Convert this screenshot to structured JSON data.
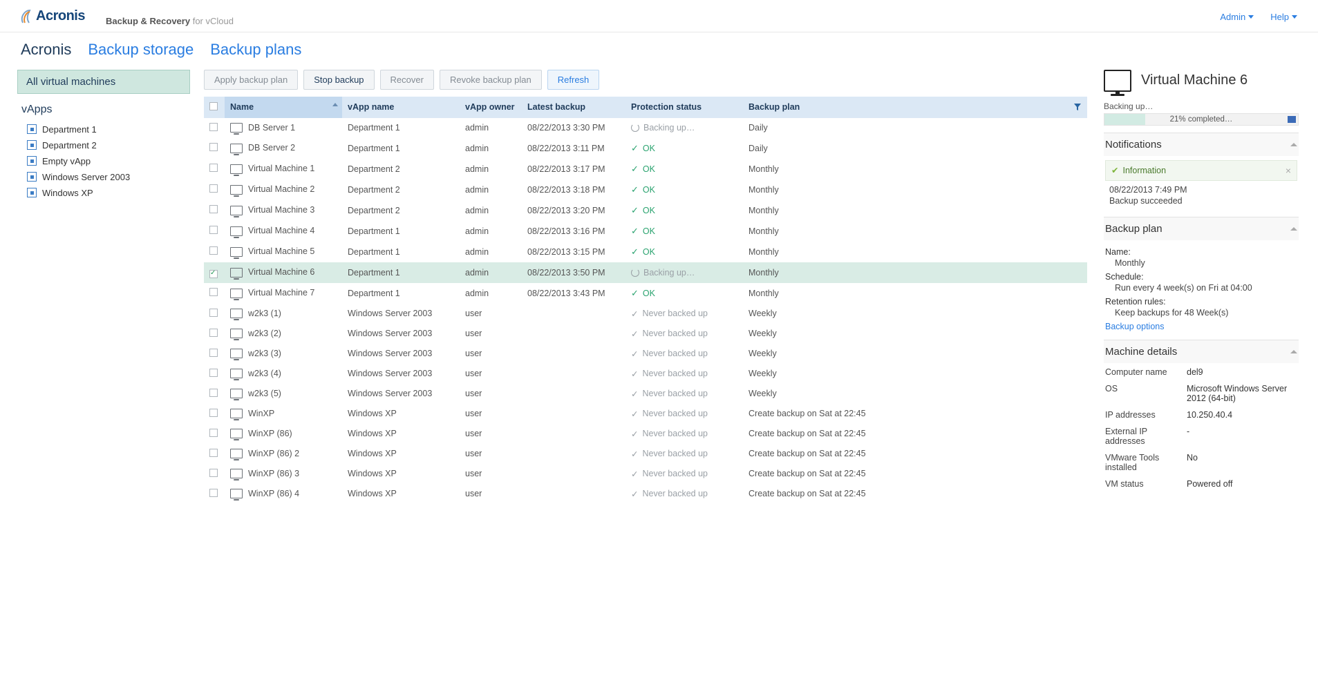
{
  "header": {
    "brand": "Acronis",
    "product_strong": "Backup & Recovery",
    "product_light": " for vCloud",
    "menu": {
      "admin": "Admin",
      "help": "Help"
    }
  },
  "tabs": {
    "t1": "Acronis",
    "t2": "Backup storage",
    "t3": "Backup plans"
  },
  "sidebar": {
    "selected": "All virtual machines",
    "heading": "vApps",
    "items": [
      "Department 1",
      "Department 2",
      "Empty vApp",
      "Windows Server 2003",
      "Windows XP"
    ]
  },
  "toolbar": {
    "apply": "Apply backup plan",
    "stop": "Stop backup",
    "recover": "Recover",
    "revoke": "Revoke backup plan",
    "refresh": "Refresh"
  },
  "columns": {
    "name": "Name",
    "vapp": "vApp name",
    "owner": "vApp owner",
    "latest": "Latest backup",
    "status": "Protection status",
    "plan": "Backup plan"
  },
  "rows": [
    {
      "name": "DB Server 1",
      "vapp": "Department 1",
      "owner": "admin",
      "latest": "08/22/2013 3:30 PM",
      "status": "Backing up…",
      "kind": "busy",
      "plan": "Daily",
      "sel": false
    },
    {
      "name": "DB Server 2",
      "vapp": "Department 1",
      "owner": "admin",
      "latest": "08/22/2013 3:11 PM",
      "status": "OK",
      "kind": "ok",
      "plan": "Daily",
      "sel": false
    },
    {
      "name": "Virtual Machine 1",
      "vapp": "Department 2",
      "owner": "admin",
      "latest": "08/22/2013 3:17 PM",
      "status": "OK",
      "kind": "ok",
      "plan": "Monthly",
      "sel": false
    },
    {
      "name": "Virtual Machine 2",
      "vapp": "Department 2",
      "owner": "admin",
      "latest": "08/22/2013 3:18 PM",
      "status": "OK",
      "kind": "ok",
      "plan": "Monthly",
      "sel": false
    },
    {
      "name": "Virtual Machine 3",
      "vapp": "Department 2",
      "owner": "admin",
      "latest": "08/22/2013 3:20 PM",
      "status": "OK",
      "kind": "ok",
      "plan": "Monthly",
      "sel": false
    },
    {
      "name": "Virtual Machine 4",
      "vapp": "Department 1",
      "owner": "admin",
      "latest": "08/22/2013 3:16 PM",
      "status": "OK",
      "kind": "ok",
      "plan": "Monthly",
      "sel": false
    },
    {
      "name": "Virtual Machine 5",
      "vapp": "Department 1",
      "owner": "admin",
      "latest": "08/22/2013 3:15 PM",
      "status": "OK",
      "kind": "ok",
      "plan": "Monthly",
      "sel": false
    },
    {
      "name": "Virtual Machine 6",
      "vapp": "Department 1",
      "owner": "admin",
      "latest": "08/22/2013 3:50 PM",
      "status": "Backing up…",
      "kind": "busy",
      "plan": "Monthly",
      "sel": true
    },
    {
      "name": "Virtual Machine 7",
      "vapp": "Department 1",
      "owner": "admin",
      "latest": "08/22/2013 3:43 PM",
      "status": "OK",
      "kind": "ok",
      "plan": "Monthly",
      "sel": false
    },
    {
      "name": "w2k3 (1)",
      "vapp": "Windows Server 2003",
      "owner": "user",
      "latest": "",
      "status": "Never backed up",
      "kind": "never",
      "plan": "Weekly",
      "sel": false
    },
    {
      "name": "w2k3 (2)",
      "vapp": "Windows Server 2003",
      "owner": "user",
      "latest": "",
      "status": "Never backed up",
      "kind": "never",
      "plan": "Weekly",
      "sel": false
    },
    {
      "name": "w2k3 (3)",
      "vapp": "Windows Server 2003",
      "owner": "user",
      "latest": "",
      "status": "Never backed up",
      "kind": "never",
      "plan": "Weekly",
      "sel": false
    },
    {
      "name": "w2k3 (4)",
      "vapp": "Windows Server 2003",
      "owner": "user",
      "latest": "",
      "status": "Never backed up",
      "kind": "never",
      "plan": "Weekly",
      "sel": false
    },
    {
      "name": "w2k3 (5)",
      "vapp": "Windows Server 2003",
      "owner": "user",
      "latest": "",
      "status": "Never backed up",
      "kind": "never",
      "plan": "Weekly",
      "sel": false
    },
    {
      "name": "WinXP",
      "vapp": "Windows XP",
      "owner": "user",
      "latest": "",
      "status": "Never backed up",
      "kind": "never",
      "plan": "Create backup on Sat at 22:45",
      "sel": false
    },
    {
      "name": "WinXP (86)",
      "vapp": "Windows XP",
      "owner": "user",
      "latest": "",
      "status": "Never backed up",
      "kind": "never",
      "plan": "Create backup on Sat at 22:45",
      "sel": false
    },
    {
      "name": "WinXP (86) 2",
      "vapp": "Windows XP",
      "owner": "user",
      "latest": "",
      "status": "Never backed up",
      "kind": "never",
      "plan": "Create backup on Sat at 22:45",
      "sel": false
    },
    {
      "name": "WinXP (86) 3",
      "vapp": "Windows XP",
      "owner": "user",
      "latest": "",
      "status": "Never backed up",
      "kind": "never",
      "plan": "Create backup on Sat at 22:45",
      "sel": false
    },
    {
      "name": "WinXP (86) 4",
      "vapp": "Windows XP",
      "owner": "user",
      "latest": "",
      "status": "Never backed up",
      "kind": "never",
      "plan": "Create backup on Sat at 22:45",
      "sel": false
    }
  ],
  "details": {
    "title": "Virtual Machine 6",
    "progress_label": "Backing up…",
    "progress_text": "21% completed…",
    "progress_pct": 21,
    "notifications": {
      "heading": "Notifications",
      "info_label": "Information",
      "ts": "08/22/2013 7:49 PM",
      "msg": "Backup succeeded"
    },
    "plan": {
      "heading": "Backup plan",
      "name_k": "Name:",
      "name_v": "Monthly",
      "sched_k": "Schedule:",
      "sched_v": "Run every 4 week(s) on Fri at 04:00",
      "ret_k": "Retention rules:",
      "ret_v": "Keep backups for 48 Week(s)",
      "options": "Backup options"
    },
    "machine": {
      "heading": "Machine details",
      "k_comp": "Computer name",
      "v_comp": "del9",
      "k_os": "OS",
      "v_os": "Microsoft Windows Server 2012 (64-bit)",
      "k_ip": "IP addresses",
      "v_ip": "10.250.40.4",
      "k_eip": "External IP addresses",
      "v_eip": "-",
      "k_tools": "VMware Tools installed",
      "v_tools": "No",
      "k_vs": "VM status",
      "v_vs": "Powered off"
    }
  }
}
